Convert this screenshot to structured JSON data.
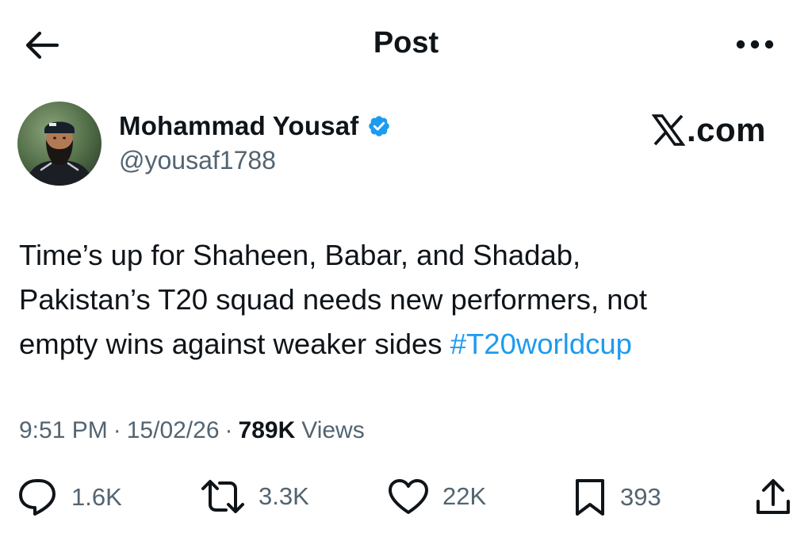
{
  "header": {
    "title": "Post",
    "back_icon": "arrow-left-icon",
    "more_icon": "more-horizontal-icon"
  },
  "author": {
    "display_name": "Mohammad Yousaf",
    "handle": "@yousaf1788",
    "verified": true,
    "verified_icon": "verified-badge-icon",
    "verified_color": "#1d9bf0"
  },
  "watermark": {
    "logo": "x-logo",
    "suffix": ".com"
  },
  "tweet": {
    "line1": "Time’s up for Shaheen, Babar, and Shadab,",
    "line2": "Pakistan’s T20 squad needs new performers, not",
    "line3_text": "empty wins against weaker sides",
    "hashtag": "#T20worldcup"
  },
  "meta": {
    "time": "9:51 PM",
    "separator": "·",
    "date": "15/02/26",
    "views_count": "789K",
    "views_label": "Views"
  },
  "actions": {
    "replies": {
      "icon": "reply-icon",
      "count": "1.6K"
    },
    "reposts": {
      "icon": "repost-icon",
      "count": "3.3K"
    },
    "likes": {
      "icon": "heart-icon",
      "count": "22K"
    },
    "bookmarks": {
      "icon": "bookmark-icon",
      "count": "393"
    },
    "share": {
      "icon": "share-icon"
    }
  },
  "colors": {
    "text_primary": "#0f1419",
    "text_secondary": "#536471",
    "link": "#1d9bf0"
  }
}
